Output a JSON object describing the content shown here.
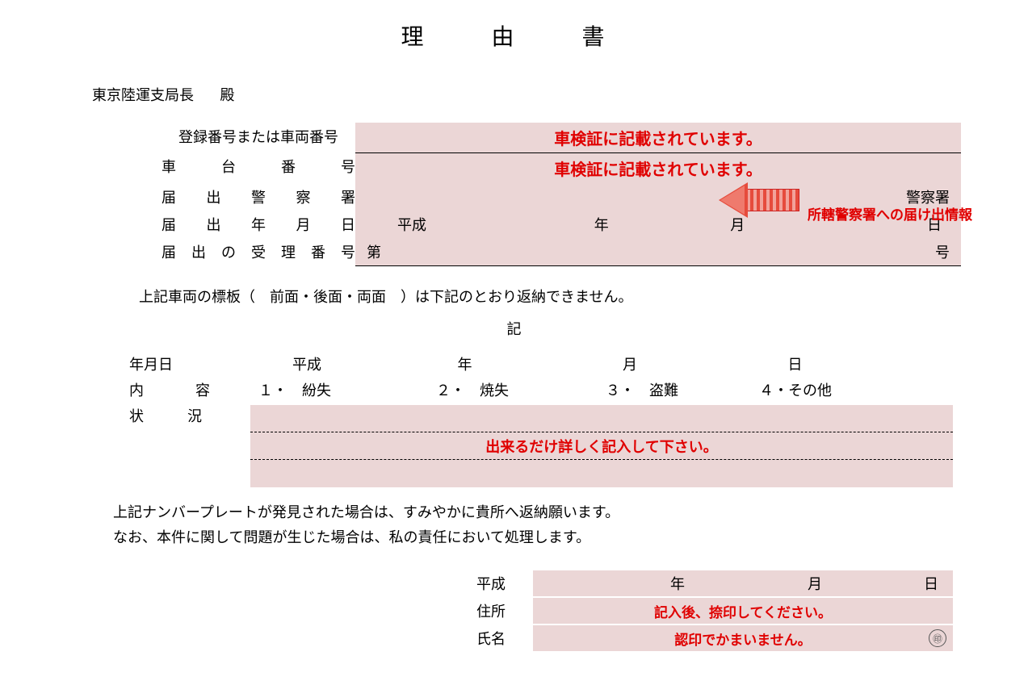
{
  "title": "理　由　書",
  "addressee": {
    "name": "東京陸運支局長",
    "honorific": "殿"
  },
  "top": {
    "rows": [
      {
        "label": "登録番号または車両番号",
        "note": "車検証に記載されています。"
      },
      {
        "label": "車　台　番　号",
        "note": "車検証に記載されています。"
      }
    ],
    "police_label": "届 出 警 察 署",
    "police_suffix": "警察署",
    "date_label": "届 出 年 月 日",
    "date": {
      "era": "平成",
      "y": "年",
      "m": "月",
      "d": "日"
    },
    "receipt_label": "届 出 の 受 理 番 号",
    "receipt": {
      "prefix": "第",
      "suffix": "号"
    },
    "callout": "所轄警察署への届け出情報"
  },
  "plate_sentence": {
    "pre": "上記車両の標板（",
    "choices": "　前面・後面・両面　",
    "post": "）は下記のとおり返納できません。"
  },
  "ki": "記",
  "mid": {
    "date_label": "年月日",
    "date": {
      "era": "平成",
      "y": "年",
      "m": "月",
      "d": "日"
    },
    "content_label": "内　容",
    "options": [
      "１・　紛失",
      "２・　焼失",
      "３・　盗難",
      "４・その他"
    ],
    "situation_label": "状　況",
    "situation_note": "出来るだけ詳しく記入して下さい。"
  },
  "footer": {
    "line1": "上記ナンバープレートが発見された場合は、すみやかに貴所へ返納願います。",
    "line2": "なお、本件に関して問題が生じた場合は、私の責任において処理します。"
  },
  "sign": {
    "era": "平成",
    "date": {
      "y": "年",
      "m": "月",
      "d": "日"
    },
    "addr_label": "住所",
    "addr_note": "記入後、捺印してください。",
    "name_label": "氏名",
    "name_note": "認印でかまいません。",
    "seal": "㊞"
  }
}
